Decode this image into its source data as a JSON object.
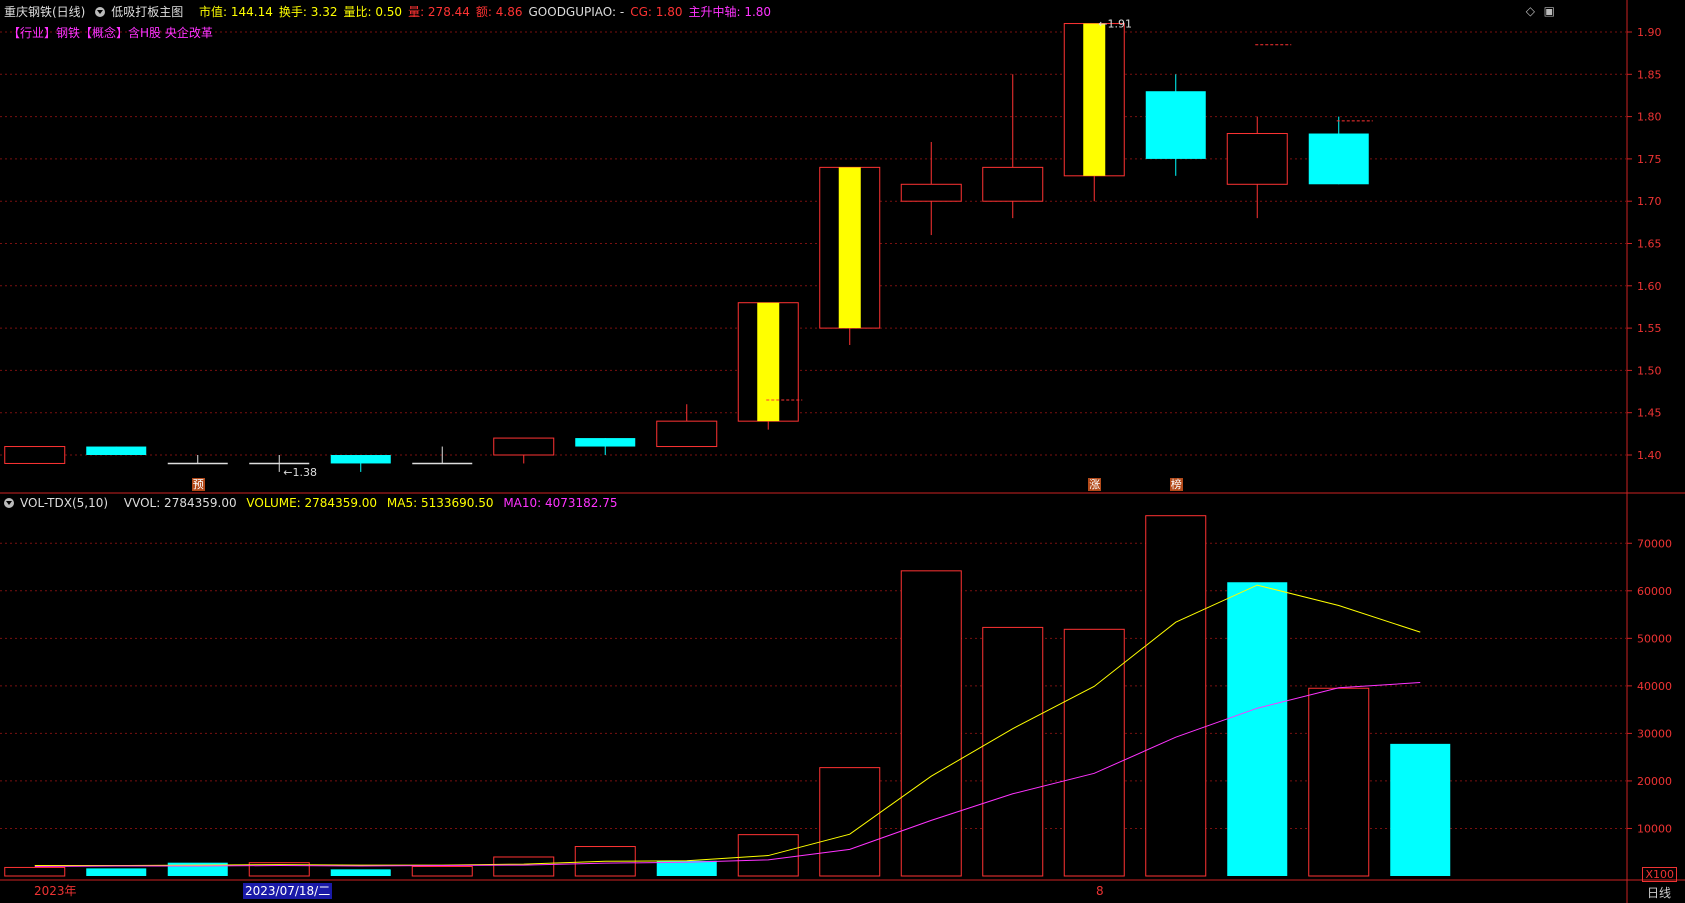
{
  "header": {
    "stock_name": "重庆钢铁(日线)",
    "indicator_name": "低吸打板主图",
    "items": [
      {
        "label": "市值:",
        "value": "144.14",
        "color": "#ffff00"
      },
      {
        "label": "换手:",
        "value": "3.32",
        "color": "#ffff00"
      },
      {
        "label": "量比:",
        "value": "0.50",
        "color": "#ffff00"
      },
      {
        "label": "量:",
        "value": "278.44",
        "color": "#ff3333"
      },
      {
        "label": "额:",
        "value": "4.86",
        "color": "#ff3333"
      },
      {
        "label": "GOODGUPIAO:",
        "value": "-",
        "color": "#dddddd"
      },
      {
        "label": "CG:",
        "value": "1.80",
        "color": "#ff3333"
      },
      {
        "label": "主升中轴:",
        "value": "1.80",
        "color": "#ff33ff"
      }
    ]
  },
  "tags": "【行业】钢铁【概念】含H股 央企改革",
  "volume_header": {
    "name": "VOL-TDX(5,10)",
    "vvol": "VVOL: 2784359.00",
    "volume": "VOLUME: 2784359.00",
    "ma5": "MA5: 5133690.50",
    "ma10": "MA10: 4073182.75"
  },
  "x_axis": {
    "year_label": "2023年",
    "selected_date": "2023/07/18/二",
    "mark": "8",
    "unit_label": "X100",
    "period_label": "日线"
  },
  "colors": {
    "up": "#ff3333",
    "down": "#00ffff",
    "limit_up": "#ffff00",
    "ma5": "#ffff00",
    "ma10": "#ff33ff",
    "grid": "#7a1010",
    "axis": "#cc2222"
  },
  "chart_data": [
    {
      "type": "candlestick",
      "title": "重庆钢铁(日线)",
      "ylim": [
        1.37,
        1.92
      ],
      "yticks": [
        "1.40",
        "1.45",
        "1.50",
        "1.55",
        "1.60",
        "1.65",
        "1.70",
        "1.75",
        "1.80",
        "1.85",
        "1.90"
      ],
      "annotations": [
        {
          "text": "1.38",
          "index": 3
        },
        {
          "text": "1.91",
          "index": 13
        }
      ],
      "badges": [
        {
          "text": "预",
          "index": 2
        },
        {
          "text": "涨",
          "index": 13
        },
        {
          "text": "榜",
          "index": 14
        }
      ],
      "candles": [
        {
          "o": 1.39,
          "h": 1.41,
          "l": 1.39,
          "c": 1.41,
          "kind": "up"
        },
        {
          "o": 1.41,
          "h": 1.41,
          "l": 1.4,
          "c": 1.4,
          "kind": "down"
        },
        {
          "o": 1.39,
          "h": 1.4,
          "l": 1.39,
          "c": 1.39,
          "kind": "flat"
        },
        {
          "o": 1.39,
          "h": 1.4,
          "l": 1.38,
          "c": 1.39,
          "kind": "flat"
        },
        {
          "o": 1.4,
          "h": 1.4,
          "l": 1.38,
          "c": 1.39,
          "kind": "down"
        },
        {
          "o": 1.39,
          "h": 1.41,
          "l": 1.39,
          "c": 1.39,
          "kind": "flat"
        },
        {
          "o": 1.4,
          "h": 1.42,
          "l": 1.39,
          "c": 1.42,
          "kind": "up"
        },
        {
          "o": 1.42,
          "h": 1.42,
          "l": 1.4,
          "c": 1.41,
          "kind": "down"
        },
        {
          "o": 1.41,
          "h": 1.46,
          "l": 1.41,
          "c": 1.44,
          "kind": "up"
        },
        {
          "o": 1.44,
          "h": 1.58,
          "l": 1.43,
          "c": 1.58,
          "kind": "limit"
        },
        {
          "o": 1.55,
          "h": 1.74,
          "l": 1.53,
          "c": 1.74,
          "kind": "limit"
        },
        {
          "o": 1.7,
          "h": 1.77,
          "l": 1.66,
          "c": 1.72,
          "kind": "up"
        },
        {
          "o": 1.7,
          "h": 1.85,
          "l": 1.68,
          "c": 1.74,
          "kind": "up"
        },
        {
          "o": 1.73,
          "h": 1.91,
          "l": 1.7,
          "c": 1.91,
          "kind": "limit"
        },
        {
          "o": 1.83,
          "h": 1.85,
          "l": 1.73,
          "c": 1.75,
          "kind": "down"
        },
        {
          "o": 1.72,
          "h": 1.8,
          "l": 1.68,
          "c": 1.78,
          "kind": "up"
        },
        {
          "o": 1.78,
          "h": 1.8,
          "l": 1.72,
          "c": 1.72,
          "kind": "down"
        }
      ],
      "dashed_levels": [
        {
          "value": 1.465,
          "index": 9
        },
        {
          "value": 1.885,
          "index": 15
        },
        {
          "value": 1.795,
          "index": 16
        }
      ]
    },
    {
      "type": "bar",
      "title": "VOL-TDX(5,10)",
      "ylim": [
        0,
        77000
      ],
      "yticks": [
        "10000",
        "20000",
        "30000",
        "40000",
        "50000",
        "60000",
        "70000"
      ],
      "unit": "X100",
      "values": [
        1800,
        1600,
        2800,
        2800,
        1400,
        2000,
        4000,
        6200,
        3200,
        8700,
        22800,
        64200,
        52300,
        51900,
        75800,
        61800,
        39500,
        27800
      ],
      "kinds": [
        "up",
        "down",
        "down",
        "up",
        "down",
        "up",
        "up",
        "up",
        "down",
        "up",
        "up",
        "up",
        "up",
        "up",
        "up",
        "down",
        "up",
        "down"
      ],
      "series": [
        {
          "name": "MA5",
          "values": [
            2200,
            2200,
            2300,
            2400,
            2300,
            2300,
            2500,
            3100,
            3200,
            4300,
            8800,
            21000,
            31000,
            39900,
            53400,
            61200,
            56900,
            51300
          ]
        },
        {
          "name": "MA10",
          "values": [
            2000,
            2100,
            2100,
            2200,
            2100,
            2200,
            2300,
            2700,
            2900,
            3400,
            5600,
            11700,
            17300,
            21600,
            29200,
            35300,
            39600,
            40700
          ]
        }
      ]
    }
  ]
}
